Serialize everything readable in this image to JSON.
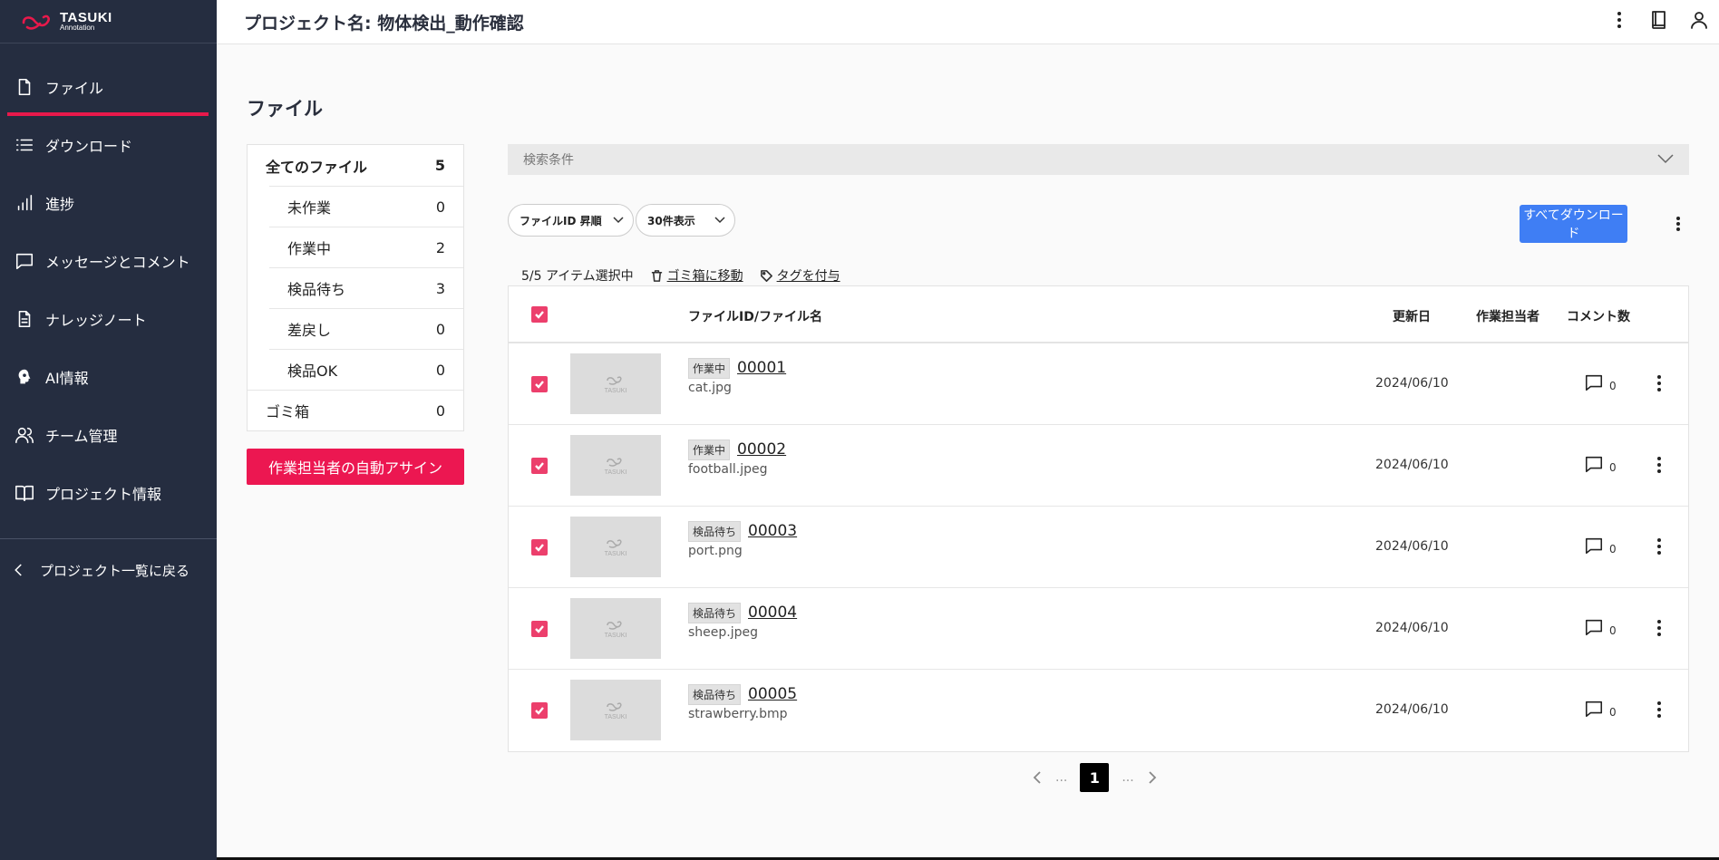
{
  "app": {
    "logo_title": "TASUKI",
    "logo_sub": "Annotation"
  },
  "header": {
    "title": "プロジェクト名: 物体検出_動作確認"
  },
  "sidebar": {
    "items": [
      {
        "label": "ファイル",
        "icon": "file-icon",
        "active": true
      },
      {
        "label": "ダウンロード",
        "icon": "list-icon"
      },
      {
        "label": "進捗",
        "icon": "bar-chart-icon"
      },
      {
        "label": "メッセージとコメント",
        "icon": "message-icon"
      },
      {
        "label": "ナレッジノート",
        "icon": "document-icon"
      },
      {
        "label": "AI情報",
        "icon": "ai-head-icon"
      },
      {
        "label": "チーム管理",
        "icon": "team-icon"
      },
      {
        "label": "プロジェクト情報",
        "icon": "book-icon"
      }
    ],
    "back_label": "プロジェクト一覧に戻る"
  },
  "page": {
    "title": "ファイル"
  },
  "filters": {
    "all": {
      "label": "全てのファイル",
      "count": "5"
    },
    "subs": [
      {
        "label": "未作業",
        "count": "0"
      },
      {
        "label": "作業中",
        "count": "2"
      },
      {
        "label": "検品待ち",
        "count": "3"
      },
      {
        "label": "差戻し",
        "count": "0"
      },
      {
        "label": "検品OK",
        "count": "0"
      }
    ],
    "trash": {
      "label": "ゴミ箱",
      "count": "0"
    }
  },
  "assign_button": "作業担当者の自動アサイン",
  "search": {
    "label": "検索条件"
  },
  "sort": {
    "order": "ファイルID 昇順",
    "per_page": "30件表示"
  },
  "download_all": "すべてダウンロード",
  "selection": {
    "text": "5/5 アイテム選択中",
    "trash_action": "ゴミ箱に移動",
    "tag_action": "タグを付与"
  },
  "table": {
    "headers": {
      "file": "ファイルID/ファイル名",
      "updated": "更新日",
      "assignee": "作業担当者",
      "comments": "コメント数"
    },
    "thumb_text": "TASUKI",
    "rows": [
      {
        "status": "作業中",
        "id": "00001",
        "name": "cat.jpg",
        "date": "2024/06/10",
        "comments": "0"
      },
      {
        "status": "作業中",
        "id": "00002",
        "name": "football.jpeg",
        "date": "2024/06/10",
        "comments": "0"
      },
      {
        "status": "検品待ち",
        "id": "00003",
        "name": "port.png",
        "date": "2024/06/10",
        "comments": "0"
      },
      {
        "status": "検品待ち",
        "id": "00004",
        "name": "sheep.jpeg",
        "date": "2024/06/10",
        "comments": "0"
      },
      {
        "status": "検品待ち",
        "id": "00005",
        "name": "strawberry.bmp",
        "date": "2024/06/10",
        "comments": "0"
      }
    ]
  },
  "pagination": {
    "current": "1",
    "ellipsis": "..."
  },
  "colors": {
    "sidebar_bg": "#252d40",
    "accent": "#ec1751",
    "primary": "#3f7ef4",
    "checkbox": "#ec3f6c"
  }
}
